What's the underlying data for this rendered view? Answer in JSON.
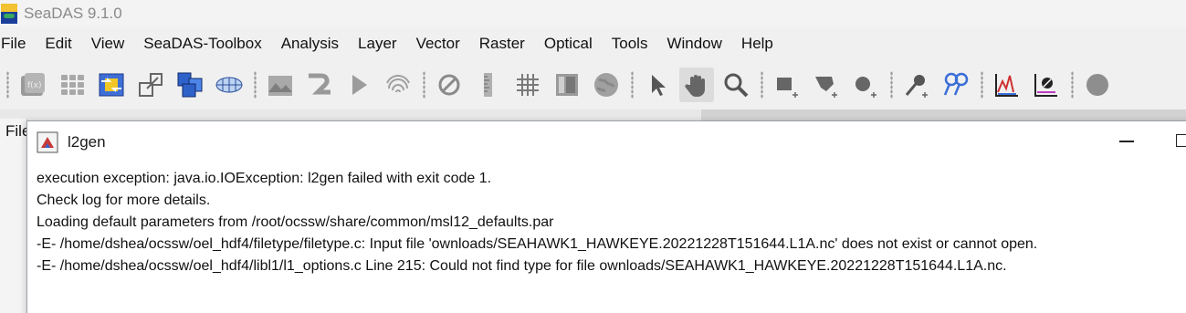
{
  "app": {
    "title": "SeaDAS 9.1.0"
  },
  "menubar": {
    "items": [
      "File",
      "Edit",
      "View",
      "SeaDAS-Toolbox",
      "Analysis",
      "Layer",
      "Vector",
      "Raster",
      "Optical",
      "Tools",
      "Window",
      "Help"
    ]
  },
  "toolbar": {
    "icons": [
      "band-maths-icon",
      "grid-icon",
      "arrows-icon",
      "subset-icon",
      "mosaic-icon",
      "globe-wire-icon",
      "image-icon",
      "snake-icon",
      "play-icon",
      "fingerprint-icon",
      "no-icon",
      "ruler-icon",
      "graticule-icon",
      "panel-icon",
      "world-icon",
      "select-icon",
      "pan-icon",
      "zoom-icon",
      "rectangle-icon",
      "polygon-icon",
      "ellipse-icon",
      "pin-icon",
      "gcp-icon",
      "spectrum-icon",
      "profile-icon",
      "circle-icon"
    ],
    "active": "pan-icon"
  },
  "workspace": {
    "side_label": "File"
  },
  "dialog": {
    "title": "l2gen",
    "lines": [
      "execution exception: java.io.IOException: l2gen failed with exit code 1.",
      "Check log for more details.",
      "Loading default parameters from /root/ocssw/share/common/msl12_defaults.par",
      "-E- /home/dshea/ocssw/oel_hdf4/filetype/filetype.c: Input file 'ownloads/SEAHAWK1_HAWKEYE.20221228T151644.L1A.nc' does not exist or cannot open.",
      "-E- /home/dshea/ocssw/oel_hdf4/libl1/l1_options.c Line 215: Could not find type for file ownloads/SEAHAWK1_HAWKEYE.20221228T151644.L1A.nc."
    ]
  },
  "colors": {
    "accent": "#3a6fd8",
    "dialog_bg": "#ffffff",
    "chrome_bg": "#f0f0f0"
  }
}
